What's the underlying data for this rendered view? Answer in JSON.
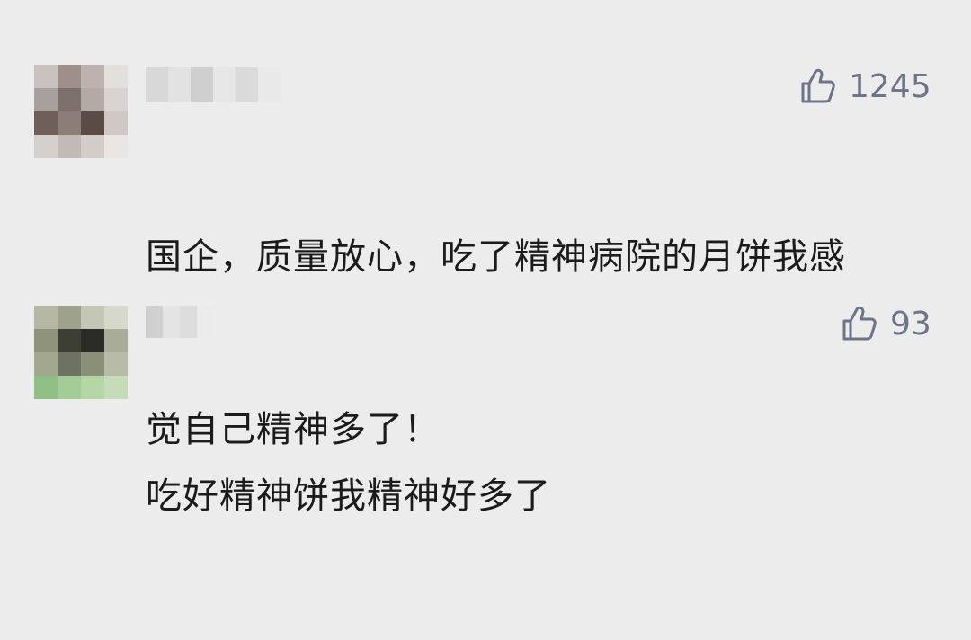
{
  "comments": [
    {
      "like_count": "1245",
      "lines": [
        "国企，质量放心，吃了精神病院的月饼我感",
        "觉自己精神多了！"
      ],
      "avatar_colors": [
        "#c9c2bf",
        "#9e8f8a",
        "#bdb3ae",
        "#e3dfdc",
        "#a8a09c",
        "#7d6f6b",
        "#b3aaa6",
        "#d9d4d1",
        "#6f5f5b",
        "#8c7d78",
        "#5a4b47",
        "#cfc8c5",
        "#d6d0cd",
        "#c2bab6",
        "#d3cdca",
        "#e8e5e3"
      ],
      "name_blur_colors": [
        "#d8d8d8",
        "#e2e2e2",
        "#cfcfcf",
        "#e6e6e6",
        "#dadada",
        "#e9e9e9"
      ]
    },
    {
      "like_count": "93",
      "lines": [
        "吃好精神饼我精神好多了"
      ],
      "avatar_colors": [
        "#b5b7a4",
        "#9ea28c",
        "#c5c7b6",
        "#d7d8cc",
        "#8f937c",
        "#3d3f35",
        "#2a2c25",
        "#a9ad97",
        "#a2a78f",
        "#6e7262",
        "#8a8f78",
        "#b8bba8",
        "#8fbf85",
        "#a4cc96",
        "#b5d6a6",
        "#c6dcb8"
      ],
      "name_blur_colors": [
        "#d0d0d0",
        "#e4e4e4",
        "#dcdcdc",
        "#ebebeb"
      ]
    }
  ],
  "colors": {
    "background": "#ececec",
    "text": "#1b1b1b",
    "like": "#6b7488"
  },
  "icons": {
    "like": "thumbs-up-icon"
  }
}
